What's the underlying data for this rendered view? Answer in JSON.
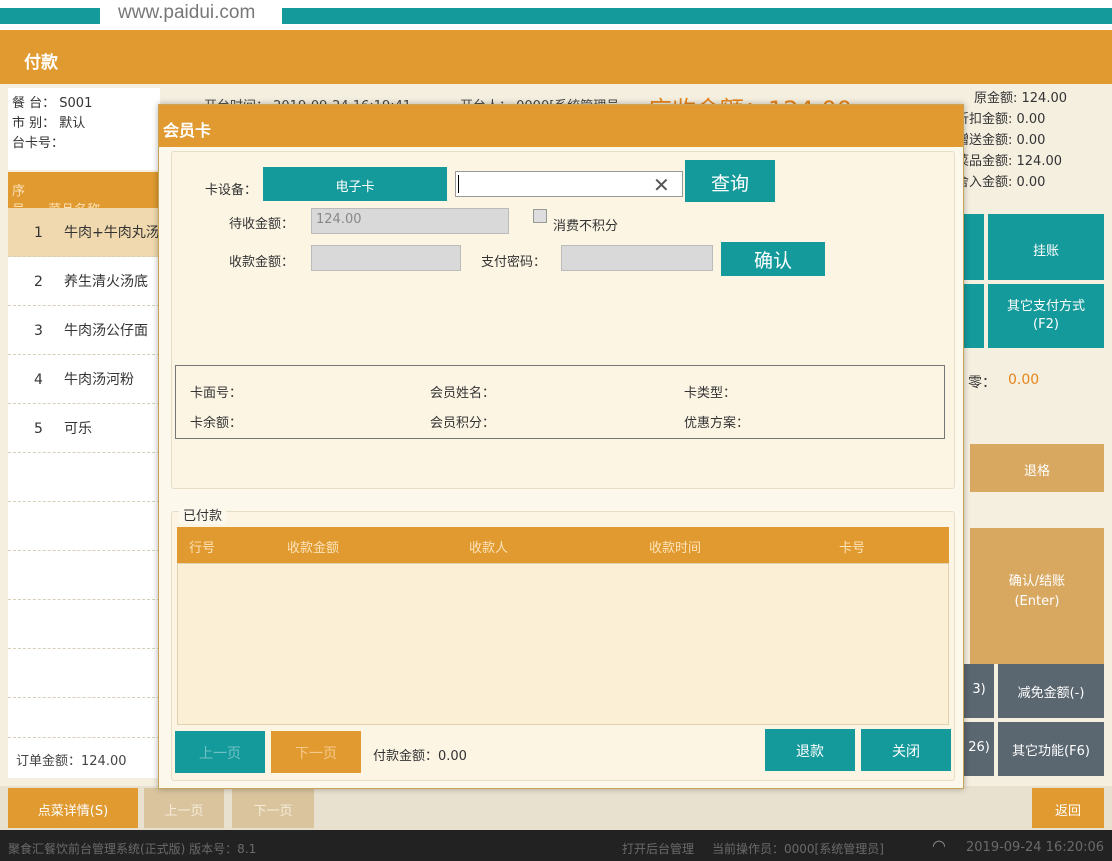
{
  "site": {
    "watermark": "www.paidui.com"
  },
  "window": {
    "title": "付款"
  },
  "table_info": {
    "table_label": "餐 台：",
    "table_value": "S001",
    "market_label": "市 别：",
    "market_value": "默认",
    "card_label": "台卡号：",
    "card_value": ""
  },
  "header_partial": {
    "open_time": "开台时间：  2019-09-24 16:19:41",
    "opener": "开台人：  0000[系统管理员",
    "receivable": "应收金额：124.00"
  },
  "dish_list": {
    "col_no": "序号",
    "col_name": "菜品名称",
    "items": [
      {
        "no": "1",
        "name": "牛肉+牛肉丸汤"
      },
      {
        "no": "2",
        "name": "养生清火汤底"
      },
      {
        "no": "3",
        "name": "牛肉汤公仔面"
      },
      {
        "no": "4",
        "name": "牛肉汤河粉"
      },
      {
        "no": "5",
        "name": "可乐"
      }
    ],
    "order_total": "订单金额：124.00"
  },
  "summary": {
    "original": "原金额: 124.00",
    "discount": "折扣金额: 0.00",
    "gift": "赠送金额: 0.00",
    "dish_amount": "菜品金额: 124.00",
    "rounding": "舍入金额: 0.00"
  },
  "right_buttons": {
    "charge": "挂账",
    "other_pay": "其它支付方式\n(F2)",
    "change_label": "零：",
    "change_value": "0.00",
    "refund_dish": "退格",
    "confirm_checkout": "确认/结账\n(Enter)",
    "partial_a": "3)",
    "reduce": "减免金额(-)",
    "partial_b": "26)",
    "other_func": "其它功能(F6)",
    "back": "返回"
  },
  "bottom_bar": {
    "dish_detail": "点菜详情(S)",
    "prev": "上一页",
    "next": "下一页"
  },
  "status_bar": {
    "app": "聚食汇餐饮前台管理系统(正式版) 版本号：8.1",
    "backend": "打开后台管理",
    "operator": "当前操作员：0000[系统管理员]",
    "datetime": "2019-09-24 16:20:06"
  },
  "modal": {
    "title": "会员卡",
    "device_label": "卡设备：",
    "device_value": "电子卡",
    "card_input_value": "",
    "query_btn": "查询",
    "pending_label": "待收金额：",
    "pending_value": "124.00",
    "no_points_label": "消费不积分",
    "receive_label": "收款金额：",
    "receive_value": "",
    "pwd_label": "支付密码：",
    "pwd_value": "",
    "confirm_btn": "确认",
    "card_no_label": "卡面号：",
    "member_name_label": "会员姓名：",
    "card_type_label": "卡类型：",
    "balance_label": "卡余额：",
    "points_label": "会员积分：",
    "promo_label": "优惠方案：",
    "paid_section": "已付款",
    "table_cols": [
      "行号",
      "收款金额",
      "收款人",
      "收款时间",
      "卡号"
    ],
    "prev_btn": "上一页",
    "next_btn": "下一页",
    "paid_amount": "付款金额：0.00",
    "refund_btn": "退款",
    "close_btn": "关闭"
  }
}
